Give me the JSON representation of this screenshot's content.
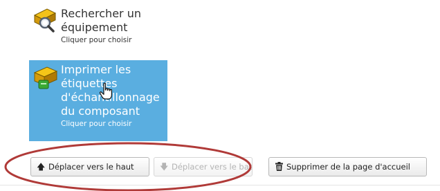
{
  "tiles": {
    "search": {
      "title": "Rechercher un équipement",
      "subtitle": "Cliquer pour choisir",
      "icon": "search-equipment-icon"
    },
    "print": {
      "title": "Imprimer les étiquettes d'échantillonnage du composant",
      "subtitle": "Cliquer pour choisir",
      "icon": "print-labels-icon",
      "highlight_color": "#5aaee0"
    }
  },
  "cursor": "hand-pointer-cursor",
  "buttons": {
    "move_up": {
      "label": "Déplacer vers le haut",
      "icon": "arrow-up-icon"
    },
    "move_down": {
      "label": "Déplacer vers le bas",
      "icon": "arrow-down-icon",
      "disabled": true
    },
    "remove": {
      "label": "Supprimer de la page d'accueil",
      "icon": "trash-icon"
    }
  },
  "annotation": {
    "shape": "ellipse",
    "color": "#b03a38"
  }
}
